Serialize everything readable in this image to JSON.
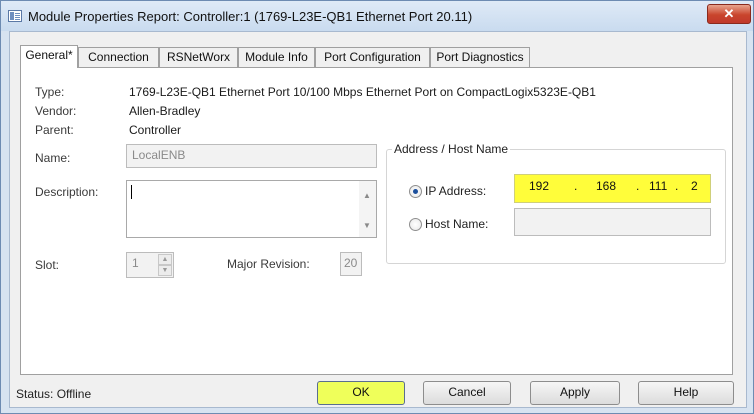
{
  "window": {
    "title": "Module Properties Report: Controller:1 (1769-L23E-QB1 Ethernet Port 20.11)",
    "close_label": "✕"
  },
  "tabs": [
    {
      "label": "General*",
      "active": true
    },
    {
      "label": "Connection",
      "active": false
    },
    {
      "label": "RSNetWorx",
      "active": false
    },
    {
      "label": "Module Info",
      "active": false
    },
    {
      "label": "Port Configuration",
      "active": false
    },
    {
      "label": "Port Diagnostics",
      "active": false
    }
  ],
  "general": {
    "type_label": "Type:",
    "type_value": "1769-L23E-QB1 Ethernet Port 10/100 Mbps Ethernet Port on CompactLogix5323E-QB1",
    "vendor_label": "Vendor:",
    "vendor_value": "Allen-Bradley",
    "parent_label": "Parent:",
    "parent_value": "Controller",
    "name_label": "Name:",
    "name_value": "LocalENB",
    "description_label": "Description:",
    "description_value": "",
    "slot_label": "Slot:",
    "slot_value": "1",
    "major_revision_label": "Major Revision:",
    "major_revision_value": "20"
  },
  "address": {
    "group_title": "Address / Host Name",
    "ip_label": "IP Address:",
    "ip_selected": true,
    "ip_octets": [
      "192",
      "168",
      "111",
      "2"
    ],
    "host_label": "Host Name:",
    "host_value": ""
  },
  "footer": {
    "status_text": "Status:  Offline",
    "ok_label": "OK",
    "cancel_label": "Cancel",
    "apply_label": "Apply",
    "help_label": "Help"
  },
  "colors": {
    "ip_highlight": "#fffd3a",
    "ok_highlight": "#efff5a",
    "close_button": "#c9452c"
  }
}
